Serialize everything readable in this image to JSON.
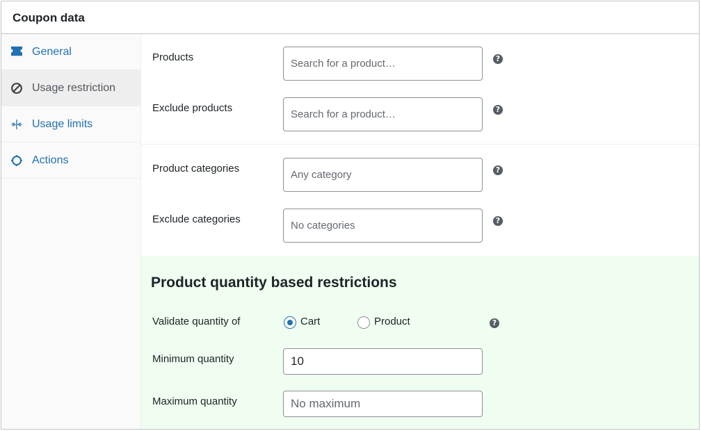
{
  "panel": {
    "title": "Coupon data"
  },
  "tabs": [
    {
      "label": "General",
      "icon": "ticket-icon",
      "active": false
    },
    {
      "label": "Usage restriction",
      "icon": "prohibited-icon",
      "active": true
    },
    {
      "label": "Usage limits",
      "icon": "arrows-in-icon",
      "active": false
    },
    {
      "label": "Actions",
      "icon": "gear-icon",
      "active": false
    }
  ],
  "fields": {
    "products": {
      "label": "Products",
      "placeholder": "Search for a product…"
    },
    "exclude_products": {
      "label": "Exclude products",
      "placeholder": "Search for a product…"
    },
    "product_categories": {
      "label": "Product categories",
      "placeholder": "Any category"
    },
    "exclude_categories": {
      "label": "Exclude categories",
      "placeholder": "No categories"
    }
  },
  "quantity": {
    "title": "Product quantity based restrictions",
    "validate_label": "Validate quantity of",
    "options": [
      {
        "label": "Cart",
        "checked": true
      },
      {
        "label": "Product",
        "checked": false
      }
    ],
    "min_label": "Minimum quantity",
    "min_value": "10",
    "max_label": "Maximum quantity",
    "max_placeholder": "No maximum"
  },
  "help_glyph": "?",
  "colors": {
    "link": "#2271b1",
    "section_bg": "#effef0",
    "sidebar_bg": "#fafafa",
    "active_tab_bg": "#eeeeee"
  }
}
